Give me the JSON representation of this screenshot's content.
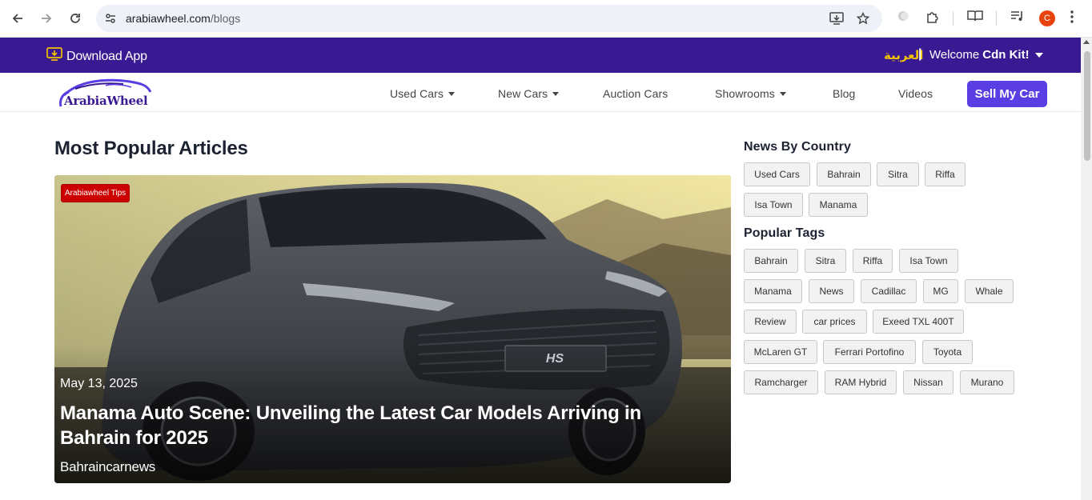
{
  "browser": {
    "url_host": "arabiawheel.com",
    "url_path": "/blogs",
    "profile_initial": "C"
  },
  "topbar": {
    "download_label": "Download App",
    "language_label": "العربية",
    "separator": "|",
    "welcome_prefix": "Welcome",
    "welcome_user": "Cdn Kit!"
  },
  "nav": {
    "logo_text": "ArabiaWheel",
    "items": [
      "Used Cars",
      "New Cars",
      "Auction Cars",
      "Showrooms",
      "Blog",
      "Videos"
    ],
    "sell_label": "Sell My Car"
  },
  "main": {
    "heading": "Most Popular Articles",
    "featured": {
      "badge": "Arabiawheel Tips",
      "date": "May 13, 2025",
      "title": "Manama Auto Scene: Unveiling the Latest Car Models Arriving in Bahrain for 2025",
      "source": "Bahraincarnews",
      "plate_text": "HS"
    }
  },
  "sidebar": {
    "news_heading": "News By Country",
    "countries": [
      "Used Cars",
      "Bahrain",
      "Sitra",
      "Riffa",
      "Isa Town",
      "Manama"
    ],
    "tags_heading": "Popular Tags",
    "tags": [
      "Bahrain",
      "Sitra",
      "Riffa",
      "Isa Town",
      "Manama",
      "News",
      "Cadillac",
      "MG",
      "Whale",
      "Review",
      "car prices",
      "Exeed TXL 400T",
      "McLaren GT",
      "Ferrari Portofino",
      "Toyota",
      "Ramcharger",
      "RAM Hybrid",
      "Nissan",
      "Murano"
    ]
  },
  "colors": {
    "brand_purple": "#3a1a92",
    "sell_button": "#5a3ee3",
    "language_gold": "#f2c200",
    "badge_red": "#cc0000"
  }
}
